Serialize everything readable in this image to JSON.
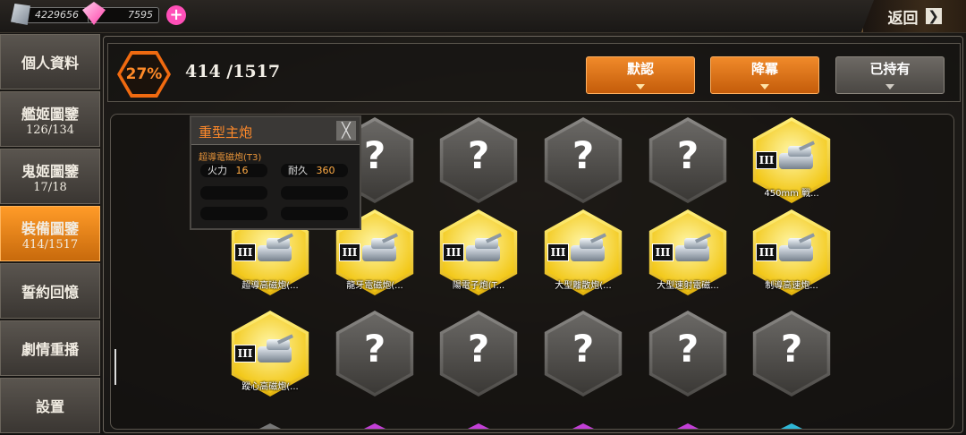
{
  "resources": {
    "iron": "4229656",
    "gems": "7595",
    "plus": "+"
  },
  "back_label": "返回",
  "back_arrow": "❯",
  "sidebar": {
    "items": [
      {
        "label": "個人資料",
        "count": ""
      },
      {
        "label": "艦姬圖鑒",
        "count": "126/134"
      },
      {
        "label": "鬼姬圖鑒",
        "count": "17/18"
      },
      {
        "label": "裝備圖鑒",
        "count": "414/1517"
      },
      {
        "label": "誓約回憶",
        "count": ""
      },
      {
        "label": "劇情重播",
        "count": ""
      },
      {
        "label": "設置",
        "count": ""
      }
    ],
    "active_index": 3
  },
  "header": {
    "percent": "27%",
    "count": "414 /1517",
    "buttons": [
      {
        "label": "默認",
        "style": "orange"
      },
      {
        "label": "降冪",
        "style": "orange"
      },
      {
        "label": "已持有",
        "style": "gray"
      }
    ]
  },
  "tooltip": {
    "title": "重型主炮",
    "close": "╳",
    "subtitle": "超導電磁炮(T3)",
    "stats": [
      {
        "label": "火力",
        "value": "16"
      },
      {
        "label": "耐久",
        "value": "360"
      }
    ]
  },
  "grid": {
    "rows": [
      [
        {
          "state": "hidden",
          "mark": "?",
          "name": "",
          "rank": ""
        },
        {
          "state": "unknown",
          "mark": "?",
          "name": "",
          "rank": ""
        },
        {
          "state": "unknown",
          "mark": "?",
          "name": "",
          "rank": ""
        },
        {
          "state": "unknown",
          "mark": "?",
          "name": "",
          "rank": ""
        },
        {
          "state": "unknown",
          "mark": "?",
          "name": "",
          "rank": ""
        },
        {
          "state": "known",
          "mark": "",
          "name": "450mm 戰...",
          "rank": "III"
        }
      ],
      [
        {
          "state": "known",
          "mark": "",
          "name": "超導高磁炮(...",
          "rank": "III"
        },
        {
          "state": "known",
          "mark": "",
          "name": "龍牙電磁炮(...",
          "rank": "III"
        },
        {
          "state": "known",
          "mark": "",
          "name": "陽電子炮(T...",
          "rank": "III"
        },
        {
          "state": "known",
          "mark": "",
          "name": "大型離散炮(...",
          "rank": "III"
        },
        {
          "state": "known",
          "mark": "",
          "name": "大型速射電磁...",
          "rank": "III"
        },
        {
          "state": "known",
          "mark": "",
          "name": "制導高速炮...",
          "rank": "III"
        }
      ],
      [
        {
          "state": "known",
          "mark": "",
          "name": "蹤心高磁炮(...",
          "rank": "III"
        },
        {
          "state": "unknown",
          "mark": "?",
          "name": "",
          "rank": ""
        },
        {
          "state": "unknown",
          "mark": "?",
          "name": "",
          "rank": ""
        },
        {
          "state": "unknown",
          "mark": "?",
          "name": "",
          "rank": ""
        },
        {
          "state": "unknown",
          "mark": "?",
          "name": "",
          "rank": ""
        },
        {
          "state": "unknown",
          "mark": "?",
          "name": "",
          "rank": ""
        }
      ]
    ],
    "next_row_colors": [
      "#777777",
      "#c23fd6",
      "#c23fd6",
      "#c23fd6",
      "#c23fd6",
      "#2fb7d6"
    ]
  },
  "colors": {
    "accent": "#f08a2a",
    "gold": "#f2c716",
    "panel_border": "#6a645b"
  }
}
